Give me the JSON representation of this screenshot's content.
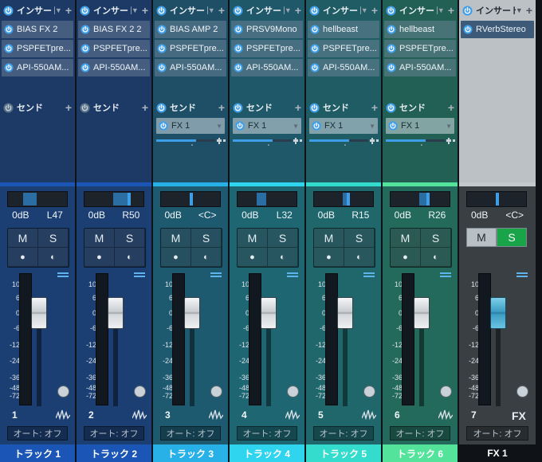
{
  "labels": {
    "insert": "インサート",
    "send": "センド",
    "automation": "オート: オフ",
    "mute": "M",
    "solo": "S",
    "fx_badge": "FX"
  },
  "colors": {
    "power_blue": "#3f9ee8",
    "track_blue": "#1b56b6",
    "track_cyan": "#2fd4ee",
    "track_green": "#53e39a",
    "fx_gray": "#c3c8cc",
    "solo_green": "#19a44a"
  },
  "icons": {
    "power": "power-icon",
    "add": "plus-icon",
    "dropdown": "triangle-down-icon",
    "mute_record": "circle-icon",
    "monitor": "half-circle-icon",
    "waveform": "waveform-icon",
    "pan_knob": "knob-icon"
  },
  "fader_scale": [
    "10",
    "6",
    "0",
    "-6",
    "-12",
    "-24",
    "-36",
    "-48",
    "-72"
  ],
  "strips": [
    {
      "number": "1",
      "name": "トラック 1",
      "inserts": [
        "BIAS FX 2",
        "PSPFETpre...",
        "API-550AM..."
      ],
      "sends": [],
      "volume": "0dB",
      "pan": "L47",
      "fader_level": 0,
      "color_band": "#1b56b6",
      "top_bg": "#1d3a66",
      "bottom_bg": "#1c3f73"
    },
    {
      "number": "2",
      "name": "トラック 2",
      "inserts": [
        "BIAS FX 2 2",
        "PSPFETpre...",
        "API-550AM..."
      ],
      "sends": [],
      "volume": "0dB",
      "pan": "R50",
      "fader_level": 0,
      "color_band": "#1b56b6",
      "top_bg": "#1d3a66",
      "bottom_bg": "#1c3f73"
    },
    {
      "number": "3",
      "name": "トラック 3",
      "inserts": [
        "BIAS AMP 2",
        "PSPFETpre...",
        "API-550AM..."
      ],
      "sends": [
        "FX 1"
      ],
      "volume": "0dB",
      "pan": "<C>",
      "fader_level": 0,
      "color_band": "#27b1e6",
      "top_bg": "#1e4f66",
      "bottom_bg": "#1d5a70"
    },
    {
      "number": "4",
      "name": "トラック 4",
      "inserts": [
        "PRSV9Mono",
        "PSPFETpre...",
        "API-550AM..."
      ],
      "sends": [
        "FX 1"
      ],
      "volume": "0dB",
      "pan": "L32",
      "fader_level": 0,
      "color_band": "#2fd4ee",
      "top_bg": "#1f5868",
      "bottom_bg": "#1e6672"
    },
    {
      "number": "5",
      "name": "トラック 5",
      "inserts": [
        "hellbeast",
        "PSPFETpre...",
        "API-550AM..."
      ],
      "sends": [
        "FX 1"
      ],
      "volume": "0dB",
      "pan": "R15",
      "fader_level": 0,
      "color_band": "#33dccc",
      "top_bg": "#1f5c64",
      "bottom_bg": "#20676c"
    },
    {
      "number": "6",
      "name": "トラック 6",
      "inserts": [
        "hellbeast",
        "PSPFETpre...",
        "API-550AM..."
      ],
      "sends": [
        "FX 1"
      ],
      "volume": "0dB",
      "pan": "R26",
      "fader_level": 0,
      "color_band": "#53e39a",
      "top_bg": "#225f55",
      "bottom_bg": "#246a5c"
    },
    {
      "number": "7",
      "name": "FX 1",
      "inserts": [
        "RVerbStereo"
      ],
      "sends": [],
      "volume": "0dB",
      "pan": "<C>",
      "fader_level": 0,
      "color_band": "#c3c8cc",
      "top_bg": "#bcc1c6",
      "bottom_bg": "#3a3f44",
      "is_fx": true
    }
  ]
}
